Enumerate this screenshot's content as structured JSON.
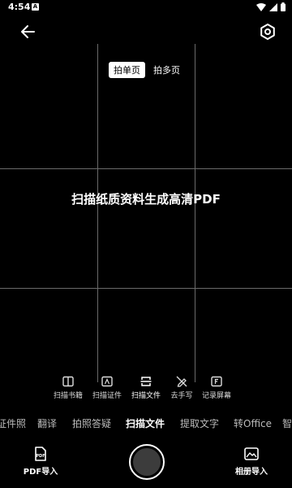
{
  "status": {
    "time": "4:54",
    "notif": "A"
  },
  "mode_toggle": {
    "single": "拍单页",
    "multi": "拍多页"
  },
  "headline": "扫描纸质资料生成高清PDF",
  "doc_types": [
    {
      "label": "扫描书籍",
      "icon": "book-icon"
    },
    {
      "label": "扫描证件",
      "icon": "id-card-icon"
    },
    {
      "label": "扫描文件",
      "icon": "scan-file-icon"
    },
    {
      "label": "去手写",
      "icon": "erase-handwriting-icon"
    },
    {
      "label": "记录屏幕",
      "icon": "record-screen-icon"
    }
  ],
  "categories": [
    "证件照",
    "翻译",
    "拍照答疑",
    "扫描文件",
    "提取文字",
    "转Office",
    "智"
  ],
  "active_category": "扫描文件",
  "bottom": {
    "pdf_label": "PDF导入",
    "pdf_badge": "PDF",
    "album_label": "相册导入"
  }
}
